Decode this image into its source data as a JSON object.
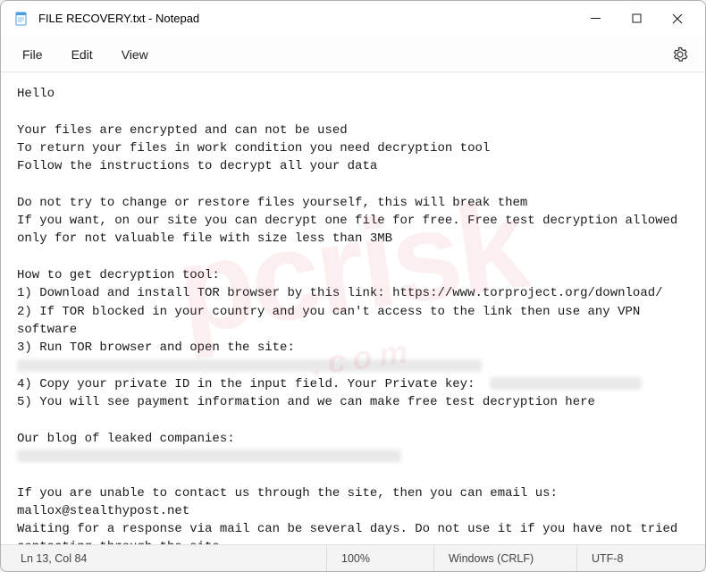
{
  "window": {
    "title": "FILE RECOVERY.txt - Notepad"
  },
  "menu": {
    "file": "File",
    "edit": "Edit",
    "view": "View"
  },
  "content": {
    "greeting": "Hello",
    "p1l1": "Your files are encrypted and can not be used",
    "p1l2": "To return your files in work condition you need decryption tool",
    "p1l3": "Follow the instructions to decrypt all your data",
    "p2l1": "Do not try to change or restore files yourself, this will break them",
    "p2l2": "If you want, on our site you can decrypt one file for free. Free test decryption allowed only for not valuable file with size less than 3MB",
    "howto_header": "How to get decryption tool:",
    "step1": "1) Download and install TOR browser by this link: https://www.torproject.org/download/",
    "step2": "2) If TOR blocked in your country and you can't access to the link then use any VPN software",
    "step3": "3) Run TOR browser and open the site:",
    "step4": "4) Copy your private ID in the input field. Your Private key:  ",
    "step5": "5) You will see payment information and we can make free test decryption here",
    "blog_header": "Our blog of leaked companies:",
    "p3l1": "If you are unable to contact us through the site, then you can email us:",
    "email": "mallox@stealthypost.net",
    "p3l2": "Waiting for a response via mail can be several days. Do not use it if you have not tried contacting through the site."
  },
  "status": {
    "position": "Ln 13, Col 84",
    "zoom": "100%",
    "eol": "Windows (CRLF)",
    "encoding": "UTF-8"
  },
  "watermark": {
    "main": "pcrisk",
    "sub": ".com"
  }
}
